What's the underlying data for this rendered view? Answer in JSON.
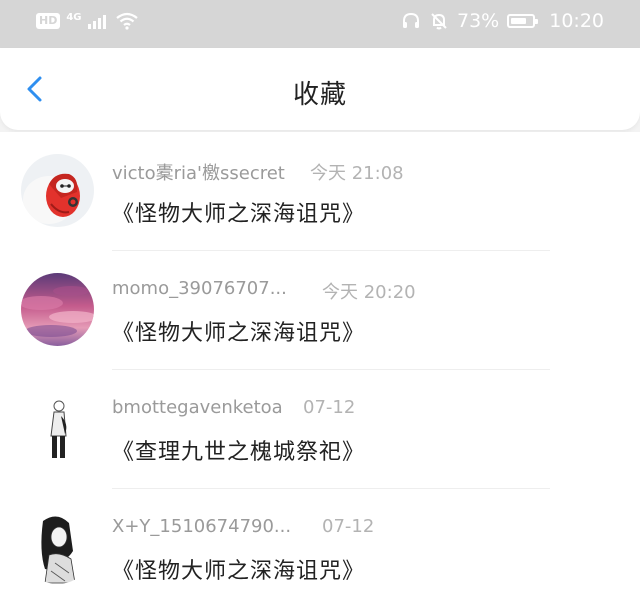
{
  "status_bar": {
    "hd": "HD",
    "network": "4G",
    "battery_text": "73%",
    "battery_level": 0.73,
    "time": "10:20",
    "icons": [
      "wifi-icon",
      "headset-icon",
      "mute-bell-icon",
      "battery-icon"
    ]
  },
  "header": {
    "title": "收藏",
    "back_icon": "chevron-left-icon",
    "accent": "#2f8ff0"
  },
  "items": [
    {
      "name": "victo橐ria'檄ssecret",
      "time": "今天 21:08",
      "subject": "《怪物大师之深海诅咒》",
      "avatar": "baymax"
    },
    {
      "name": "momo_39076707...",
      "time": "今天 20:20",
      "subject": "《怪物大师之深海诅咒》",
      "avatar": "pink-sky"
    },
    {
      "name": "bmottegavenketoa",
      "time": "07-12",
      "subject": "《查理九世之槐城祭祀》",
      "avatar": "sketch-figure"
    },
    {
      "name": "X+Y_1510674790...",
      "time": "07-12",
      "subject": "《怪物大师之深海诅咒》",
      "avatar": "anime-sketch"
    }
  ]
}
